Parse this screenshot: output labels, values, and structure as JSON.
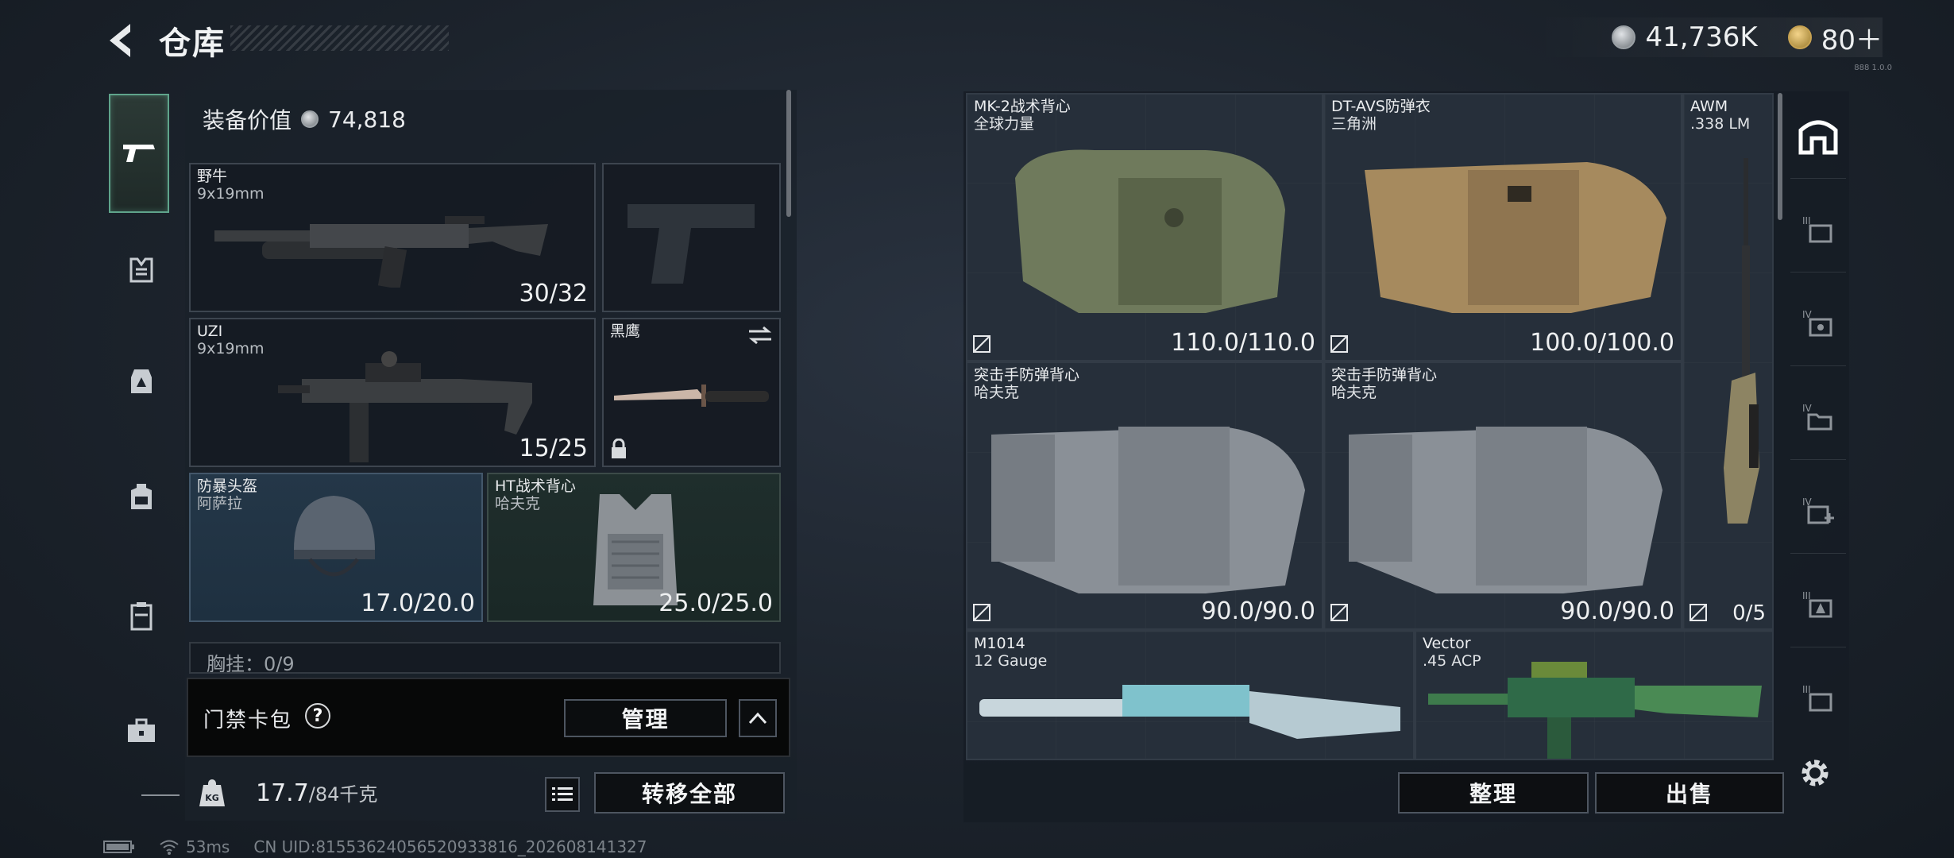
{
  "header": {
    "title": "仓库",
    "currency_silver": "41,736K",
    "currency_gold": "80＋",
    "corner_tag": "888 1.0.0"
  },
  "left_nav": {
    "items": [
      "pistol-icon",
      "vest-icon",
      "rig-icon",
      "backpack-icon",
      "case-icon",
      "toolbox-icon"
    ]
  },
  "equipment": {
    "value_label": "装备价值",
    "value": "74,818",
    "primary": {
      "name": "野牛",
      "caliber": "9x19mm",
      "ammo": "30/32"
    },
    "secondary": {
      "name": "UZI",
      "caliber": "9x19mm",
      "ammo": "15/25"
    },
    "melee": {
      "name": "黑鹰"
    },
    "helmet": {
      "name": "防暴头盔",
      "brand": "阿萨拉",
      "durability": "17.0/20.0"
    },
    "chest_rig": {
      "name": "HT战术背心",
      "brand": "哈夫克",
      "durability": "25.0/25.0"
    },
    "chest_hang": "胸挂：0/9",
    "access_card": "门禁卡包",
    "help": "?",
    "manage_button": "管理",
    "weight_current": "17.7",
    "weight_max": "/84千克",
    "transfer_all_button": "转移全部"
  },
  "storage": {
    "items": [
      {
        "name": "MK-2战术背心",
        "brand": "全球力量",
        "durability": "110.0/110.0"
      },
      {
        "name": "DT-AVS防弹衣",
        "brand": "三角洲",
        "durability": "100.0/100.0"
      },
      {
        "name": "AWM",
        "brand": ".338 LM",
        "durability": "0/5"
      },
      {
        "name": "突击手防弹背心",
        "brand": "哈夫克",
        "durability": "90.0/90.0"
      },
      {
        "name": "突击手防弹背心",
        "brand": "哈夫克",
        "durability": "90.0/90.0"
      },
      {
        "name": "M1014",
        "brand": "12 Gauge",
        "durability": ""
      },
      {
        "name": "Vector",
        "brand": ".45 ACP",
        "durability": ""
      }
    ],
    "sort_button": "整理",
    "sell_button": "出售"
  },
  "status_bar": {
    "ping": "53ms",
    "uid": "CN UID:81553624056520933816_202608141327"
  },
  "colors": {
    "accent_green": "#5fa48b",
    "panel": "#1a2129",
    "helmet_slot": "#243748"
  }
}
